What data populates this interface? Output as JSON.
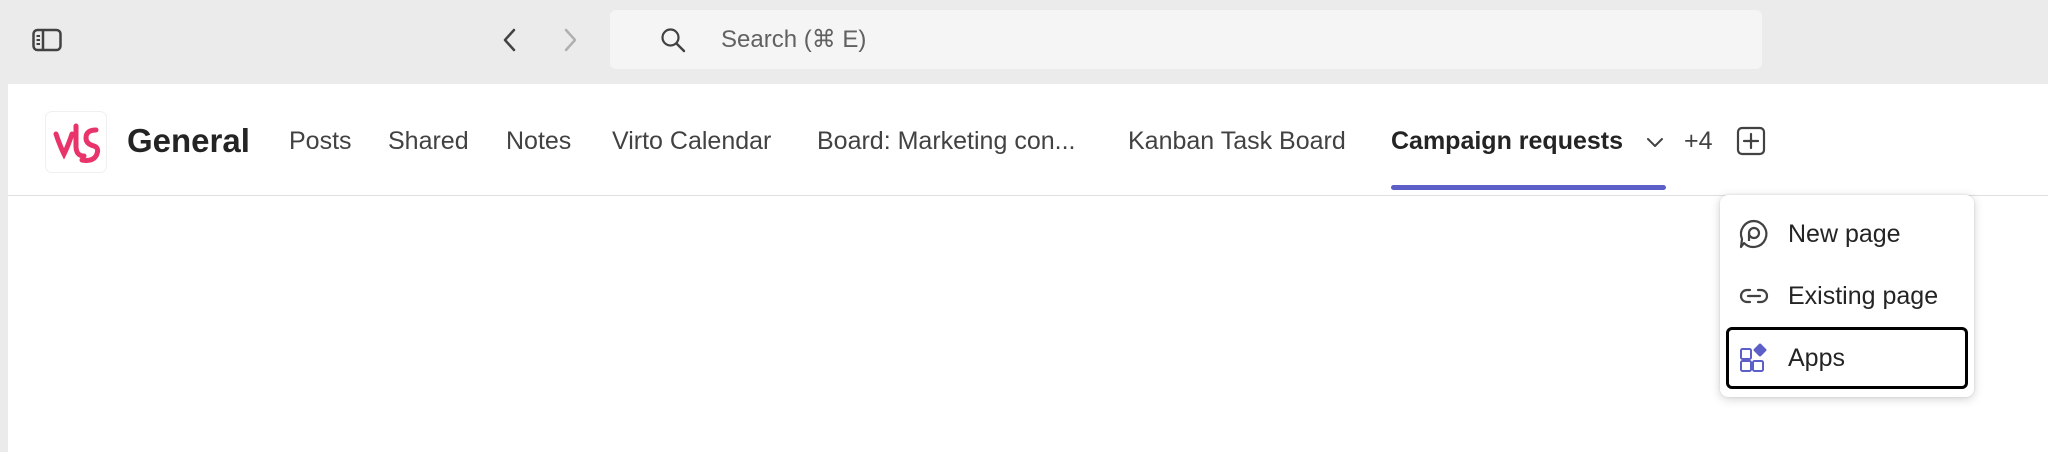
{
  "search": {
    "placeholder": "Search (⌘ E)"
  },
  "channel": {
    "title": "General"
  },
  "tabs": [
    {
      "label": "Posts"
    },
    {
      "label": "Shared"
    },
    {
      "label": "Notes"
    },
    {
      "label": "Virto Calendar"
    },
    {
      "label": "Board: Marketing con..."
    },
    {
      "label": "Kanban Task Board"
    },
    {
      "label": "Campaign requests",
      "active": true
    }
  ],
  "more_tabs": "+4",
  "add_menu": {
    "items": [
      {
        "label": "New page",
        "icon": "loop-page-icon"
      },
      {
        "label": "Existing page",
        "icon": "link-icon"
      },
      {
        "label": "Apps",
        "icon": "apps-add-icon",
        "focused": true
      }
    ]
  },
  "colors": {
    "accent": "#5b5fc7",
    "logo": "#e8336b",
    "titlebar": "#ebebeb"
  }
}
